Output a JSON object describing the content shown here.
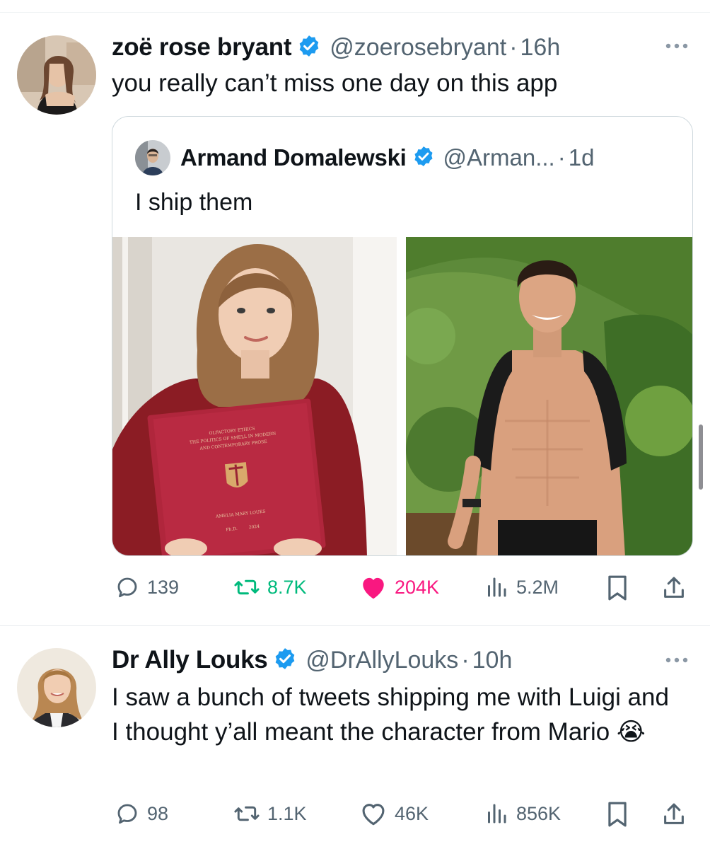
{
  "tweets": [
    {
      "name": "zoë rose bryant",
      "handle": "@zoerosebryant",
      "time": "16h",
      "text": "you really can’t miss one day on this app",
      "quote": {
        "name": "Armand Domalewski",
        "handle": "@Arman...",
        "time": "1d",
        "text": "I ship them",
        "book_lines": [
          "OLFACTORY ETHICS",
          "THE POLITICS OF SMELL IN MODERN",
          "AND CONTEMPORARY PROSE",
          "AMELIA MARY LOUKS",
          "Ph.D.",
          "2024"
        ]
      },
      "stats": {
        "replies": "139",
        "reposts": "8.7K",
        "likes": "204K",
        "views": "5.2M"
      }
    },
    {
      "name": "Dr Ally Louks",
      "handle": "@DrAllyLouks",
      "time": "10h",
      "text": "I saw a bunch of tweets shipping me with Luigi and I thought y’all meant the character from Mario 😭",
      "stats": {
        "replies": "98",
        "reposts": "1.1K",
        "likes": "46K",
        "views": "856K"
      }
    }
  ],
  "icons": {
    "verified": "verified-badge-icon",
    "reply": "reply-icon",
    "repost": "repost-icon",
    "like": "heart-icon",
    "views": "views-icon",
    "bookmark": "bookmark-icon",
    "share": "share-icon",
    "more": "more-icon"
  },
  "colors": {
    "verified": "#1d9bf0",
    "repost_active": "#00ba7c",
    "like_active": "#f91880",
    "secondary_text": "#536471"
  }
}
